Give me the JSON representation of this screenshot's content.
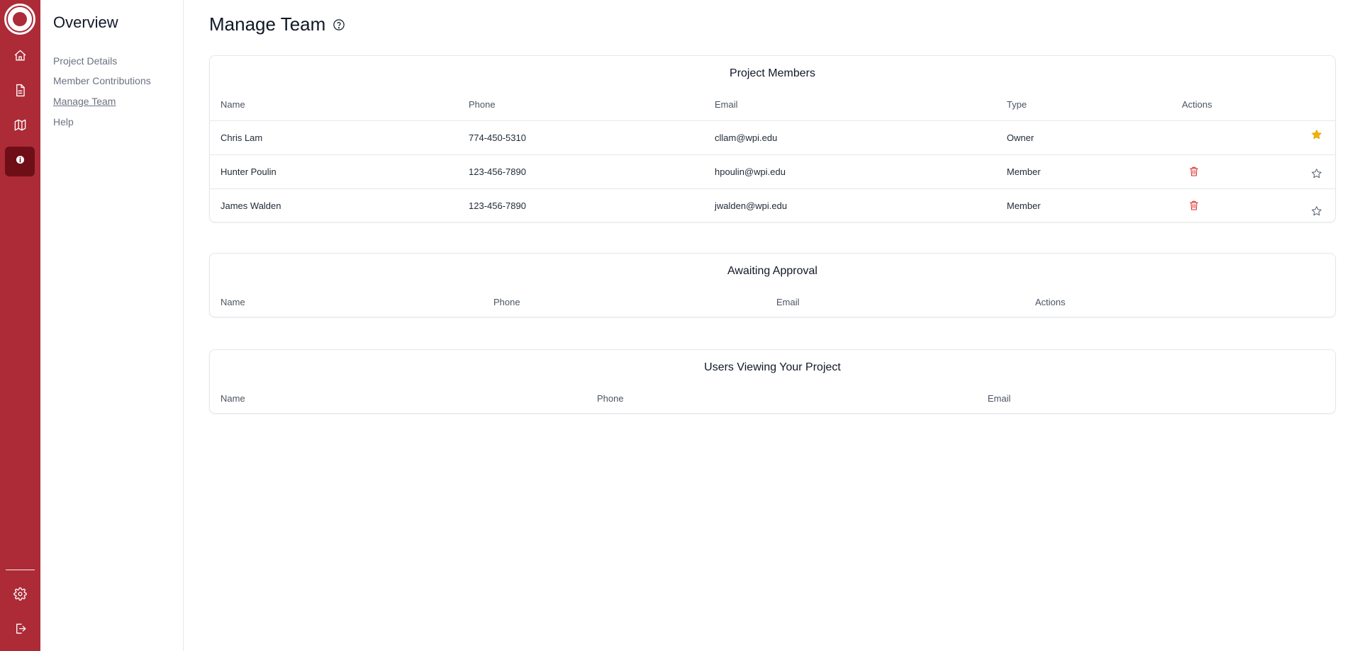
{
  "nav_rail": {
    "items": [
      {
        "icon": "home-icon"
      },
      {
        "icon": "document-icon"
      },
      {
        "icon": "map-icon"
      },
      {
        "icon": "info-icon",
        "active": true
      }
    ],
    "bottom_items": [
      {
        "icon": "gear-icon"
      },
      {
        "icon": "logout-icon"
      }
    ]
  },
  "sidebar": {
    "title": "Overview",
    "items": [
      {
        "label": "Project Details"
      },
      {
        "label": "Member Contributions"
      },
      {
        "label": "Manage Team",
        "active": true
      },
      {
        "label": "Help"
      }
    ]
  },
  "page": {
    "title": "Manage Team"
  },
  "project_members": {
    "title": "Project Members",
    "columns": [
      "Name",
      "Phone",
      "Email",
      "Type",
      "Actions"
    ],
    "rows": [
      {
        "name": "Chris Lam",
        "phone": "774-450-5310",
        "email": "cllam@wpi.edu",
        "type": "Owner",
        "deletable": false,
        "starred": true
      },
      {
        "name": "Hunter Poulin",
        "phone": "123-456-7890",
        "email": "hpoulin@wpi.edu",
        "type": "Member",
        "deletable": true,
        "starred": false
      },
      {
        "name": "James Walden",
        "phone": "123-456-7890",
        "email": "jwalden@wpi.edu",
        "type": "Member",
        "deletable": true,
        "starred": false
      }
    ]
  },
  "awaiting_approval": {
    "title": "Awaiting Approval",
    "columns": [
      "Name",
      "Phone",
      "Email",
      "Actions"
    ]
  },
  "viewers": {
    "title": "Users Viewing Your Project",
    "columns": [
      "Name",
      "Phone",
      "Email"
    ]
  },
  "colors": {
    "brand": "#ac2b37",
    "brand_active": "#6e0f18",
    "danger": "#dc2626",
    "star_active": "#f0b400"
  }
}
